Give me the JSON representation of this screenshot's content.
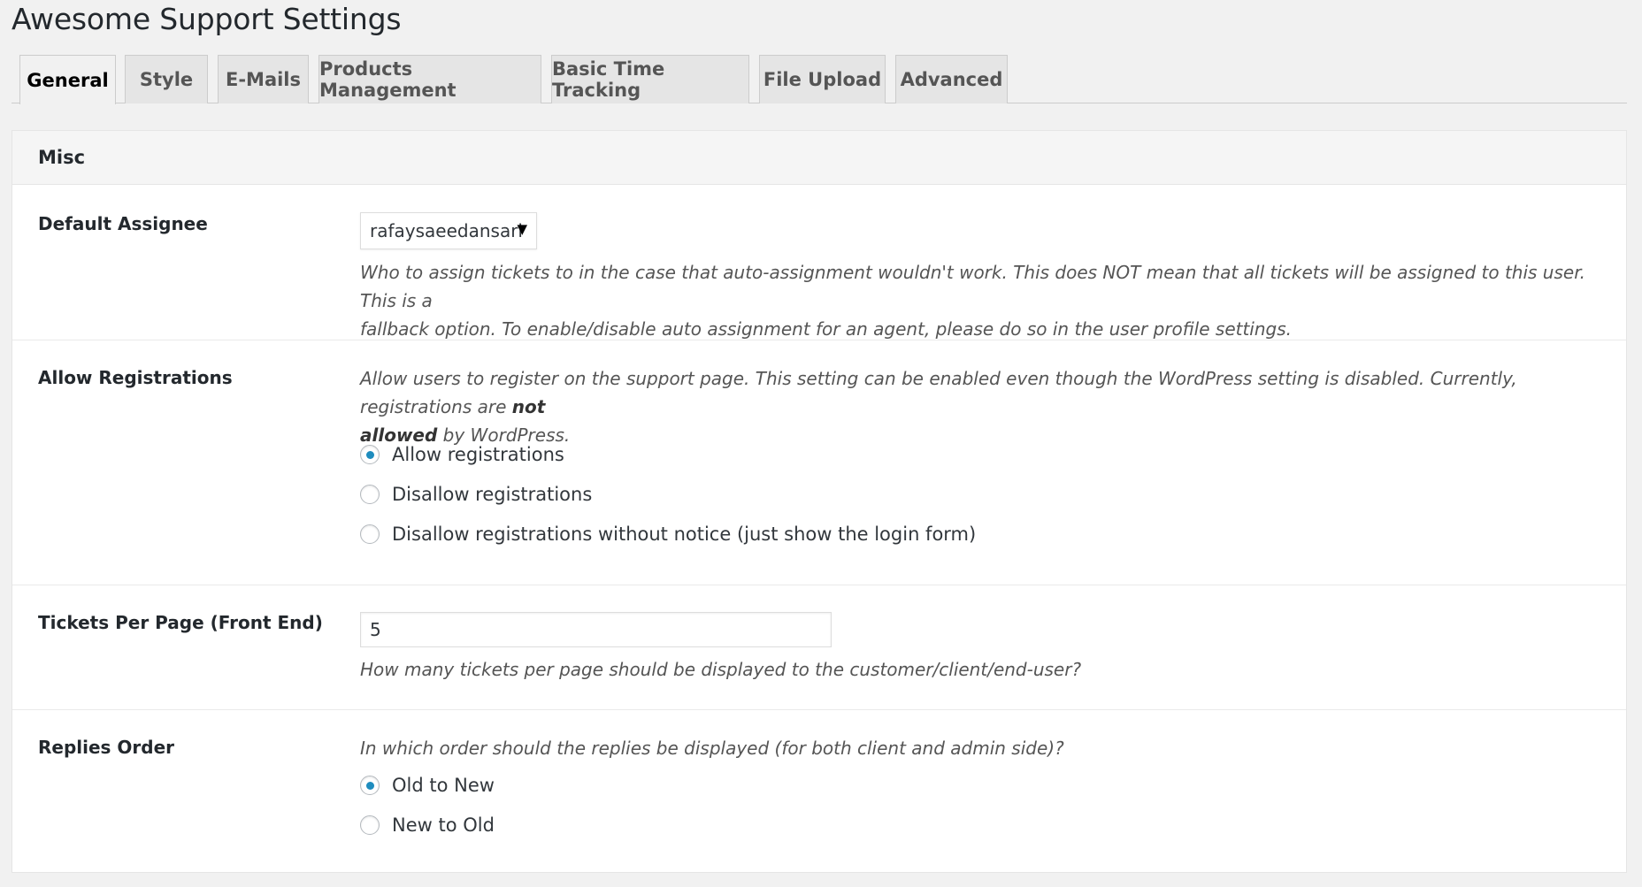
{
  "title": "Awesome Support Settings",
  "tabs": [
    {
      "label": "General",
      "active": true
    },
    {
      "label": "Style"
    },
    {
      "label": "E-Mails"
    },
    {
      "label": "Products Management"
    },
    {
      "label": "Basic Time Tracking"
    },
    {
      "label": "File Upload"
    },
    {
      "label": "Advanced"
    }
  ],
  "section": {
    "title": "Misc"
  },
  "default_assignee": {
    "label": "Default Assignee",
    "value": "rafaysaeedansari",
    "desc_line1": "Who to assign tickets to in the case that auto-assignment wouldn't work. This does NOT mean that all tickets will be assigned to this user. This is a",
    "desc_line2": "fallback option. To enable/disable auto assignment for an agent, please do so in the user profile settings."
  },
  "allow_registrations": {
    "label": "Allow Registrations",
    "desc_line1": "Allow users to register on the support page. This setting can be enabled even though the WordPress setting is disabled. Currently, registrations are",
    "desc_bold1": "not",
    "desc_bold2": "allowed",
    "desc_line2_rest": "by WordPress.",
    "options": [
      "Allow registrations",
      "Disallow registrations",
      "Disallow registrations without notice (just show the login form)"
    ],
    "selected": "Allow registrations"
  },
  "tickets_per_page": {
    "label": "Tickets Per Page (Front End)",
    "value": "5",
    "desc": "How many tickets per page should be displayed to the customer/client/end-user?"
  },
  "replies_order": {
    "label": "Replies Order",
    "desc": "In which order should the replies be displayed (for both client and admin side)?",
    "options": [
      "Old to New",
      "New to Old"
    ],
    "selected": "Old to New"
  },
  "colors": {
    "accent": "#1e8cbe",
    "background": "#f1f1f1"
  }
}
